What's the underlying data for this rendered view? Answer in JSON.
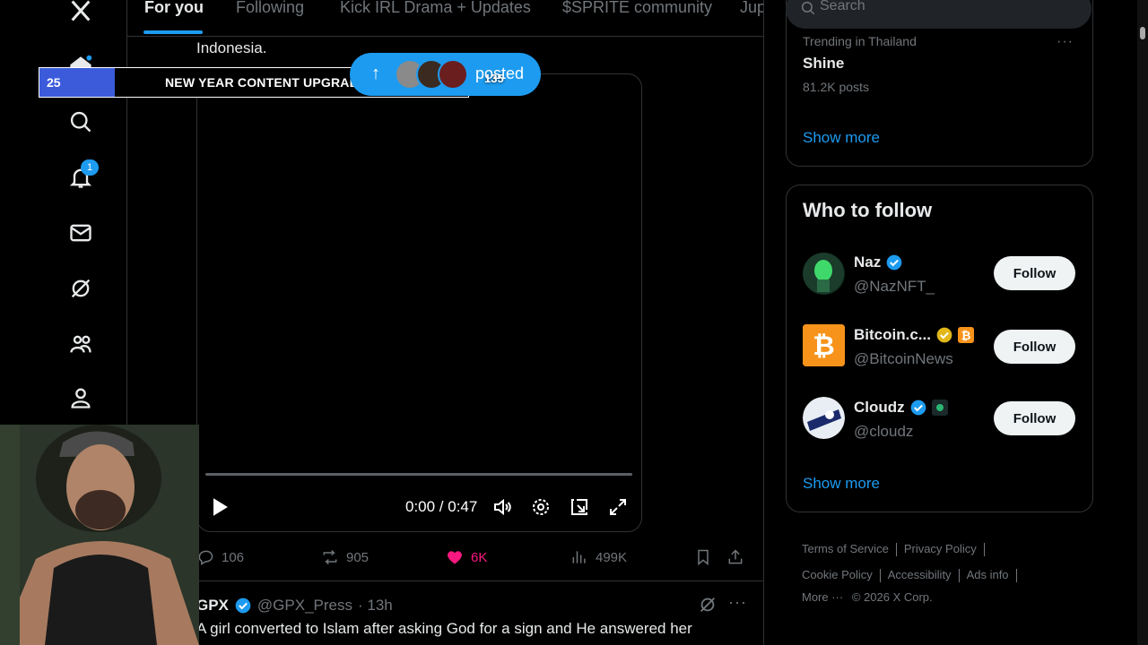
{
  "tabs": [
    {
      "label": "For you",
      "active": true
    },
    {
      "label": "Following"
    },
    {
      "label": "Kick IRL Drama + Updates"
    },
    {
      "label": "$SPRITE community"
    },
    {
      "label": "Jup"
    }
  ],
  "nav": {
    "icons": [
      "x-logo-icon",
      "home-icon",
      "search-icon",
      "notifications-icon",
      "messages-icon",
      "grok-icon",
      "communities-icon",
      "profile-icon"
    ],
    "notification_count": "1"
  },
  "tweet": {
    "text_fragment": "Indonesia.",
    "video": {
      "time": "0:00 / 0:47",
      "progress": 0
    },
    "stats": {
      "replies": "106",
      "reposts": "905",
      "likes": "6K",
      "views": "499K"
    },
    "liked": true
  },
  "next_tweet": {
    "name": "GPX",
    "handle": "@GPX_Press",
    "time": "· 13h",
    "text": "A girl converted to Islam after asking God for a sign and He answered her"
  },
  "overlay": {
    "number": "25",
    "text": "NEW YEAR CONTENT UPGRADE",
    "pill_count": "135",
    "pill_label": "posted"
  },
  "sidebar": {
    "search_placeholder": "Search",
    "trend": {
      "category": "Trending in Thailand",
      "name": "Shine",
      "count": "81.2K posts",
      "more": "···"
    },
    "trend_show_more": "Show more",
    "who_to_follow": {
      "title": "Who to follow",
      "accounts": [
        {
          "name": "Naz",
          "handle": "@NazNFT_",
          "verified": "blue",
          "follow": "Follow"
        },
        {
          "name": "Bitcoin.c...",
          "handle": "@BitcoinNews",
          "verified": "gold",
          "follow": "Follow"
        },
        {
          "name": "Cloudz",
          "handle": "@cloudz",
          "verified": "blue",
          "follow": "Follow"
        }
      ],
      "show_more": "Show more"
    },
    "footer": {
      "links": [
        "Terms of Service",
        "Privacy Policy",
        "Cookie Policy",
        "Accessibility",
        "Ads info",
        "More ···"
      ],
      "copyright": "© 2026 X Corp."
    }
  },
  "colors": {
    "accent": "#1d9bf0",
    "like": "#f91880",
    "background": "#000000",
    "gold": "#e2b719"
  }
}
